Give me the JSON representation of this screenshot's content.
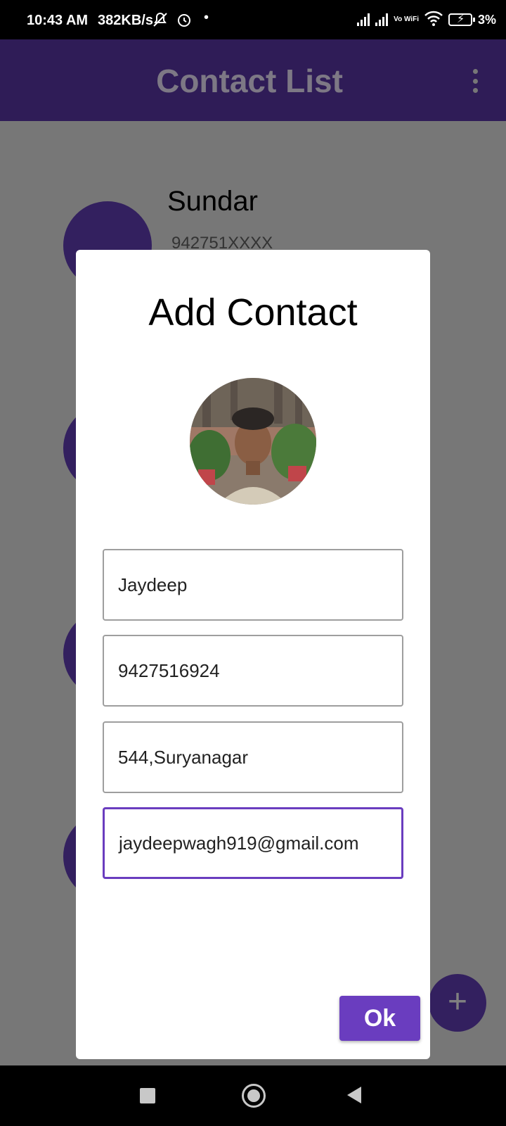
{
  "status_bar": {
    "time": "10:43 AM",
    "speed": "382KB/s",
    "vowifi": "Vo WiFi",
    "battery_percent": "3%",
    "icons": [
      "mute-icon",
      "alarm-icon",
      "signal-icon",
      "wifi-icon",
      "battery-charging-icon"
    ]
  },
  "app_bar": {
    "title": "Contact List"
  },
  "contact_list": [
    {
      "name": "Sundar",
      "phone": "942751XXXX"
    }
  ],
  "dialog": {
    "title": "Add Contact",
    "fields": {
      "name": "Jaydeep",
      "phone": "9427516924",
      "address": "544,Suryanagar",
      "email": "jaydeepwagh919@gmail.com"
    },
    "ok_label": "Ok"
  },
  "fab": {
    "label": "+"
  },
  "colors": {
    "app_bar": "#2f1c57",
    "accent": "#6a3dbf",
    "scrim": "#777777"
  }
}
